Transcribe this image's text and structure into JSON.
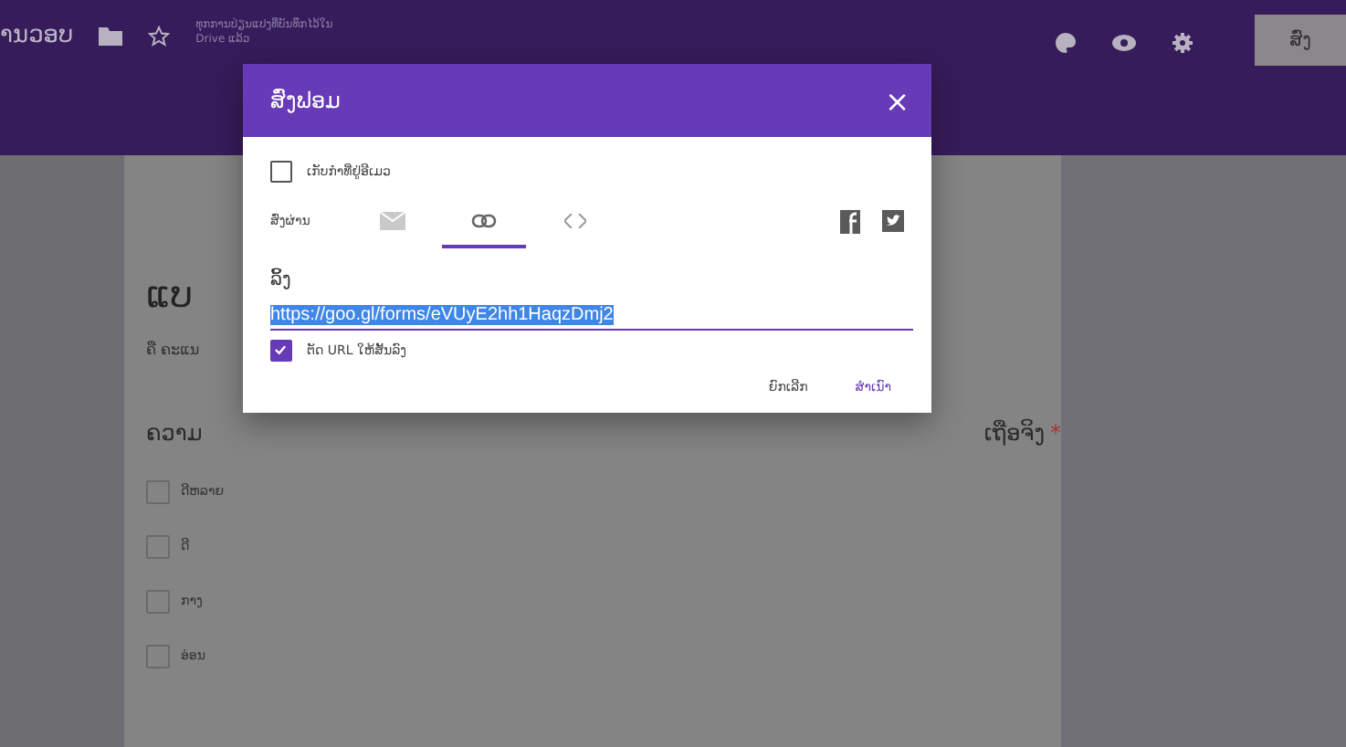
{
  "top_bar": {
    "title": "ານວອບ",
    "save_status": [
      "ທຸກການປ່ຽນແປງທີ່ບັນທຶກໄວ້ໃນ",
      "Drive ແລ້ວ"
    ],
    "send_button": {
      "label": "ສົ່ງ",
      "disabled": true
    }
  },
  "form": {
    "title": "ແບ",
    "description": "ຄື ຄະແນ",
    "question_start": "ຄວາມ",
    "question_end": "ເຖືອຈິງ",
    "required_mark": "*",
    "options": [
      {
        "label": "ດີຫລາຍ",
        "checked": false
      },
      {
        "label": "ດີ",
        "checked": false
      },
      {
        "label": "ກາງ",
        "checked": false
      },
      {
        "label": "ອ່ອນ",
        "checked": false
      }
    ]
  },
  "dialog": {
    "title": "ສົ່ງຟອມ",
    "close": "×",
    "collect_emails": {
      "label": "ເກັບກຳທີ່ຢູ່ອີເມວ",
      "checked": false
    },
    "send_via_label": "ສົ່ງຜ່ານ",
    "tabs": [
      {
        "kind": "email",
        "selected": false
      },
      {
        "kind": "link",
        "selected": true
      },
      {
        "kind": "embed",
        "selected": false
      }
    ],
    "link_label": "ລິ້ງ",
    "url": {
      "value": "https://goo.gl/forms/eVUyE2hh1HaqzDmj2",
      "highlighted": true
    },
    "shorten_url": {
      "label": "ຕັດ URL ໃຫ້ສັ້ນລົງ",
      "checked": true
    },
    "buttons": [
      {
        "label": "ຍົກເລີກ",
        "kind": "plain"
      },
      {
        "label": "ສຳເນົາ",
        "kind": "primary"
      }
    ]
  }
}
